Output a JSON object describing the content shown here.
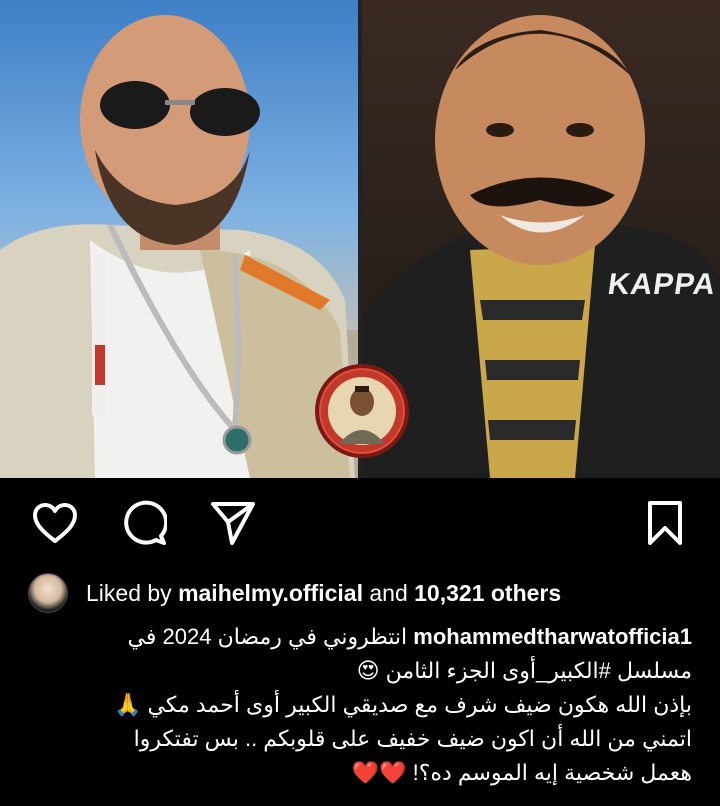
{
  "post": {
    "images": [
      {
        "subject": "man-with-aviator-sunglasses-portrait"
      },
      {
        "subject": "man-with-mustache-portrait"
      }
    ],
    "badge_icon": "profile-picture-badge",
    "brand_text": "KAPPA"
  },
  "actions": {
    "like_icon": "heart-outline-icon",
    "comment_icon": "comment-bubble-icon",
    "share_icon": "paper-plane-icon",
    "save_icon": "bookmark-icon"
  },
  "likes": {
    "prefix": "Liked by",
    "user": "maihelmy.official",
    "connector": "and",
    "count": "10,321 others"
  },
  "caption": {
    "username": "mohammedtharwatofficia1",
    "line1": "انتظروني في رمضان 2024 في",
    "line2": "مسلسل #الكبير_أوى الجزء الثامن 😍",
    "line3": "بإذن الله هكون ضيف شرف مع صديقي الكبير أوى أحمد مكي 🙏",
    "line4": "اتمني من الله أن اكون ضيف خفيف على قلوبكم .. بس تفتكروا",
    "line5": "هعمل شخصية إيه الموسم ده؟! ❤️❤️"
  },
  "colors": {
    "background": "#000000",
    "text": "#ffffff",
    "badge_ring": "#c0392b"
  }
}
